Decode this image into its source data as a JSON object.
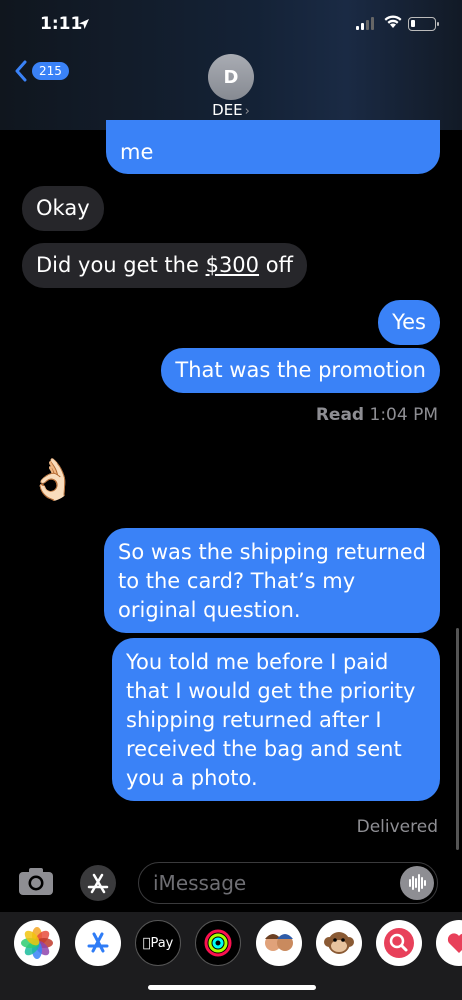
{
  "status_bar": {
    "time": "1:11",
    "location_arrow": "location-arrow-icon"
  },
  "header": {
    "back_badge": "215",
    "avatar_initial": "D",
    "contact_name": "DEE",
    "chevron": "›"
  },
  "messages": [
    {
      "type": "outgoing",
      "text": "me"
    },
    {
      "type": "incoming",
      "text": "Okay"
    },
    {
      "type": "incoming",
      "text_before": "Did you get the ",
      "text_link": "$300",
      "text_after": " off"
    },
    {
      "type": "outgoing",
      "text": "Yes"
    },
    {
      "type": "outgoing",
      "text": "That was the promotion"
    },
    {
      "type": "receipt",
      "label": "Read",
      "time": "1:04 PM"
    },
    {
      "type": "incoming-emoji",
      "text": "👌🏻"
    },
    {
      "type": "outgoing",
      "text": "So was the shipping returned to the card? That’s my original question."
    },
    {
      "type": "outgoing",
      "text": "You told me before I paid that I would get the priority shipping returned after I received the bag and sent you a photo."
    },
    {
      "type": "receipt",
      "label": "Delivered"
    }
  ],
  "input": {
    "placeholder": "iMessage"
  },
  "app_drawer": {
    "apple_pay_label": "Pay",
    "apps": [
      "photos-icon",
      "app-store-icon",
      "apple-pay-icon",
      "activity-icon",
      "memoji-icon",
      "monkey-animoji-icon",
      "search-images-icon",
      "heart-sticker-icon"
    ]
  },
  "colors": {
    "outgoing": "#3a82f7",
    "incoming": "#26262a",
    "background": "#000000"
  }
}
